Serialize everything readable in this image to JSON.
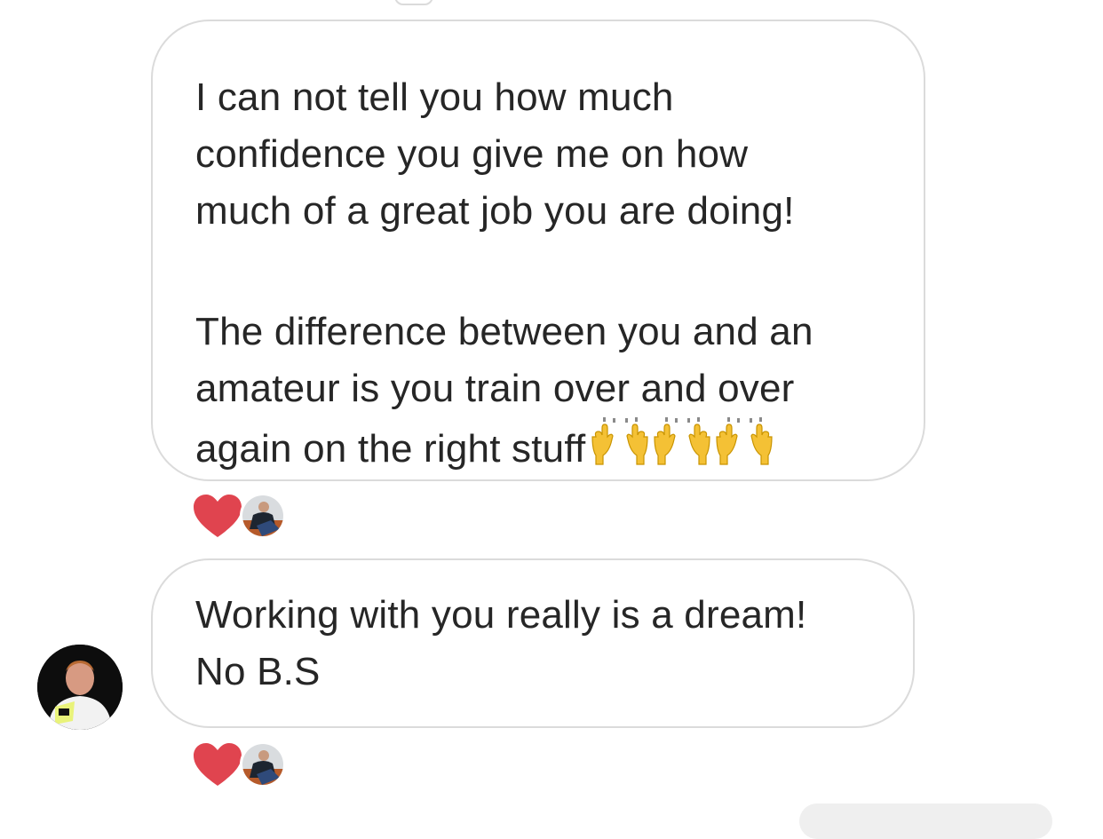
{
  "messages": [
    {
      "paragraphs": [
        [
          "I can not tell you how much",
          "confidence you give me on how",
          "much of a great job you are doing!"
        ],
        [
          "The difference between you and an",
          "amateur is you train over and over",
          "again on the right stuff"
        ]
      ],
      "emoji": "raising-hands-icon",
      "emoji_count": 3,
      "reaction": "heart-icon"
    },
    {
      "lines": [
        "Working with you really is a dream!",
        "No B.S"
      ],
      "reaction": "heart-icon"
    }
  ],
  "colors": {
    "bubble_border": "#dbdbdb",
    "text": "#262626",
    "heart": "#ed4956",
    "emoji": "#f6c23a",
    "bubble_fill_outgoing": "#efefef"
  }
}
